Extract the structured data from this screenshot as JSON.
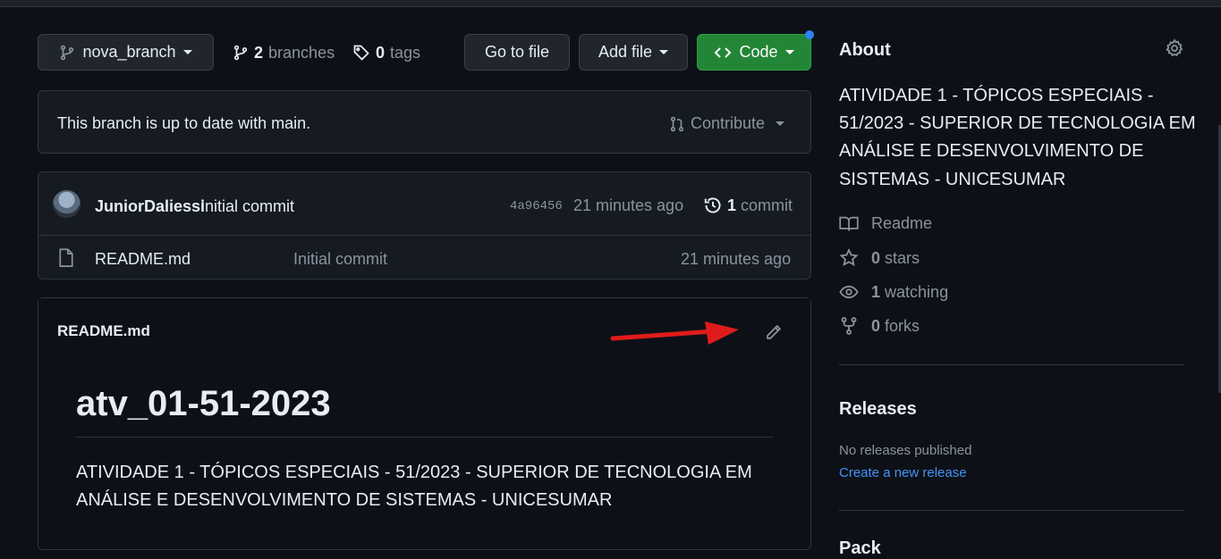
{
  "branch_selector": {
    "label": "nova_branch"
  },
  "branches": {
    "count": "2",
    "label": "branches"
  },
  "tags": {
    "count": "0",
    "label": "tags"
  },
  "toolbar": {
    "go_to_file": "Go to file",
    "add_file": "Add file",
    "code": "Code"
  },
  "branch_status": {
    "message": "This branch is up to date with main.",
    "contribute": "Contribute"
  },
  "latest_commit": {
    "author": "JuniorDaliessi",
    "message": "Initial commit",
    "sha": "4a96456",
    "time": "21 minutes ago",
    "count": "1",
    "count_label": "commit"
  },
  "files": [
    {
      "name": "README.md",
      "message": "Initial commit",
      "time": "21 minutes ago"
    }
  ],
  "readme": {
    "filename": "README.md",
    "heading": "atv_01-51-2023",
    "body_line1": "ATIVIDADE 1 - TÓPICOS ESPECIAIS - 51/2023 - SUPERIOR DE TECNOLOGIA EM",
    "body_line2": "ANÁLISE E DESENVOLVIMENTO DE SISTEMAS - UNICESUMAR"
  },
  "about": {
    "title": "About",
    "description_lines": [
      "ATIVIDADE 1 - TÓPICOS ESPECIAIS -",
      "51/2023 - SUPERIOR DE TECNOLOGIA EM",
      "ANÁLISE E DESENVOLVIMENTO DE",
      "SISTEMAS - UNICESUMAR"
    ],
    "readme": "Readme",
    "stars_count": "0",
    "stars_label": "stars",
    "watching_count": "1",
    "watching_label": "watching",
    "forks_count": "0",
    "forks_label": "forks"
  },
  "releases": {
    "title": "Releases",
    "none": "No releases published",
    "create": "Create a new release"
  },
  "next_section_partial": "Pack",
  "colors": {
    "accent_blue": "#4493f8",
    "green": "#238636",
    "annotation_red": "#e01b1b"
  },
  "icons": [
    "git-branch-icon",
    "tag-icon",
    "code-icon",
    "git-pull-request-icon",
    "history-icon",
    "file-icon",
    "pencil-icon",
    "gear-icon",
    "book-icon",
    "star-icon",
    "eye-icon",
    "fork-icon"
  ]
}
